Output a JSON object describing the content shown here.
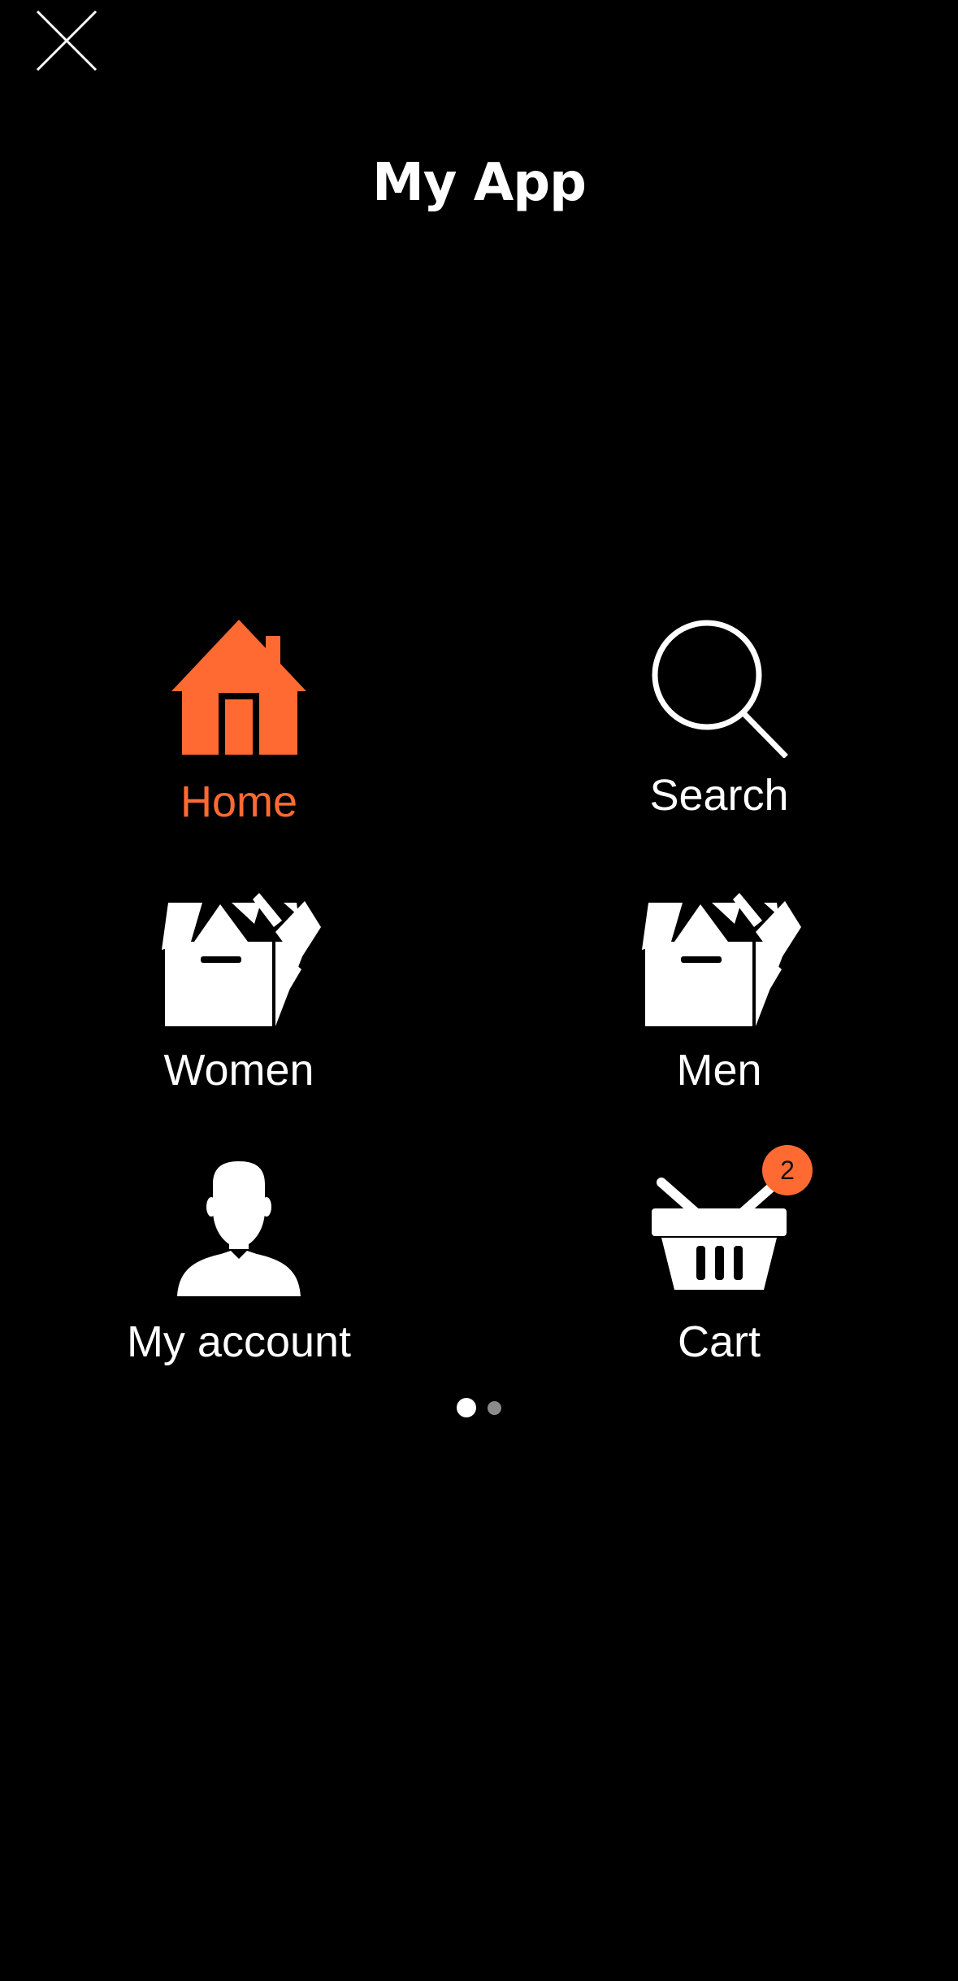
{
  "header": {
    "title": "My App",
    "close_icon": "close-icon"
  },
  "menu": {
    "items": [
      {
        "id": "home",
        "label": "Home",
        "icon": "home-icon",
        "active": true
      },
      {
        "id": "search",
        "label": "Search",
        "icon": "search-icon",
        "active": false
      },
      {
        "id": "women",
        "label": "Women",
        "icon": "box-icon",
        "active": false
      },
      {
        "id": "men",
        "label": "Men",
        "icon": "box-icon",
        "active": false
      },
      {
        "id": "account",
        "label": "My account",
        "icon": "user-icon",
        "active": false
      },
      {
        "id": "cart",
        "label": "Cart",
        "icon": "basket-icon",
        "active": false,
        "badge": "2"
      }
    ]
  },
  "pager": {
    "pages": 2,
    "current": 1
  },
  "colors": {
    "background": "#000000",
    "accent": "#ff6a33",
    "text": "#ffffff",
    "dot_inactive": "#8a8a8a"
  }
}
